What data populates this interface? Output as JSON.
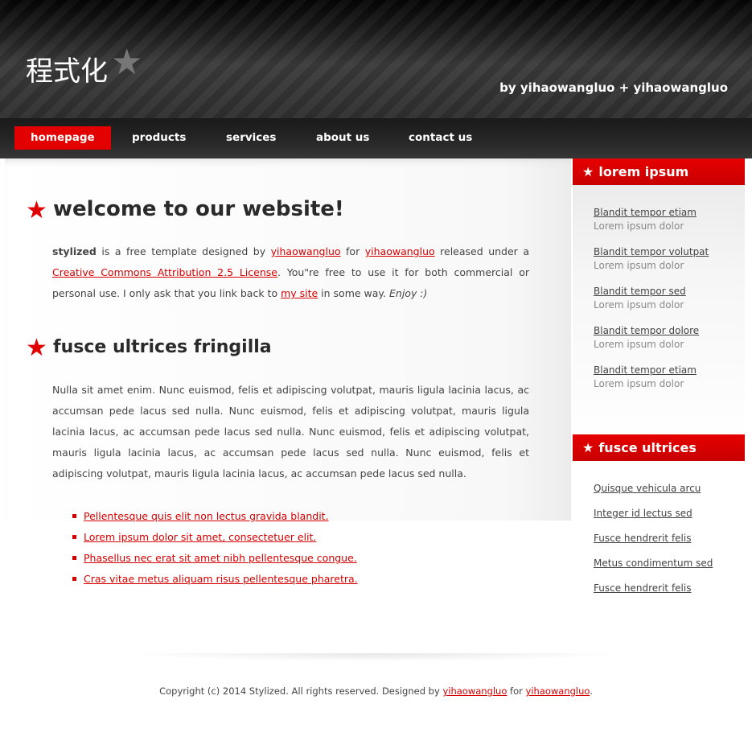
{
  "header": {
    "logo": "程式化",
    "tagline": "by yihaowangluo + yihaowangluo"
  },
  "nav": {
    "items": [
      {
        "label": "homepage"
      },
      {
        "label": "products"
      },
      {
        "label": "services"
      },
      {
        "label": "about us"
      },
      {
        "label": "contact us"
      }
    ]
  },
  "main": {
    "section1": {
      "title": "welcome to our website!",
      "p_strong": "stylized",
      "p_t1": " is a free template designed by ",
      "link1": "yihaowangluo",
      "p_t2": " for ",
      "link2": "yihaowangluo",
      "p_t3": " released under a ",
      "link3": "Creative Commons Attribution 2.5 License",
      "p_t4": ". You\"re free to use it for both commercial or personal use. I only ask that you link back to ",
      "link4": "my site",
      "p_t5": " in some way. ",
      "p_em": "Enjoy :)"
    },
    "section2": {
      "title": "fusce ultrices fringilla",
      "paragraph": "Nulla sit amet enim. Nunc euismod, felis et adipiscing volutpat, mauris ligula lacinia lacus, ac accumsan pede lacus sed nulla. Nunc euismod, felis et adipiscing volutpat, mauris ligula lacinia lacus, ac accumsan pede lacus sed nulla. Nunc euismod, felis et adipiscing volutpat, mauris ligula lacinia lacus, ac accumsan pede lacus sed nulla. Nunc euismod, felis et adipiscing volutpat, mauris ligula lacinia lacus, ac accumsan pede lacus sed nulla.",
      "links": [
        "Pellentesque quis elit non lectus gravida blandit.",
        "Lorem ipsum dolor sit amet, consectetuer elit.",
        "Phasellus nec erat sit amet nibh pellentesque congue.",
        "Cras vitae metus aliquam risus pellentesque pharetra."
      ]
    }
  },
  "sidebar": {
    "box1": {
      "title": "lorem ipsum",
      "items": [
        {
          "link": "Blandit tempor etiam",
          "sub": "Lorem ipsum dolor"
        },
        {
          "link": "Blandit tempor volutpat",
          "sub": "Lorem ipsum dolor"
        },
        {
          "link": "Blandit tempor sed",
          "sub": "Lorem ipsum dolor"
        },
        {
          "link": "Blandit tempor dolore",
          "sub": "Lorem ipsum dolor"
        },
        {
          "link": "Blandit tempor etiam",
          "sub": "Lorem ipsum dolor"
        }
      ]
    },
    "box2": {
      "title": "fusce ultrices",
      "items": [
        "Quisque vehicula arcu",
        "Integer id lectus sed",
        "Fusce hendrerit felis",
        "Metus condimentum sed",
        "Fusce hendrerit felis"
      ]
    }
  },
  "footer": {
    "t1": "Copyright (c) 2014 Stylized. All rights reserved. Designed by ",
    "link1": "yihaowangluo",
    "t2": " for ",
    "link2": "yihaowangluo",
    "t3": "."
  },
  "colors": {
    "accent": "#e30000",
    "link": "#d60000",
    "header_dark": "#1a1a1a"
  }
}
